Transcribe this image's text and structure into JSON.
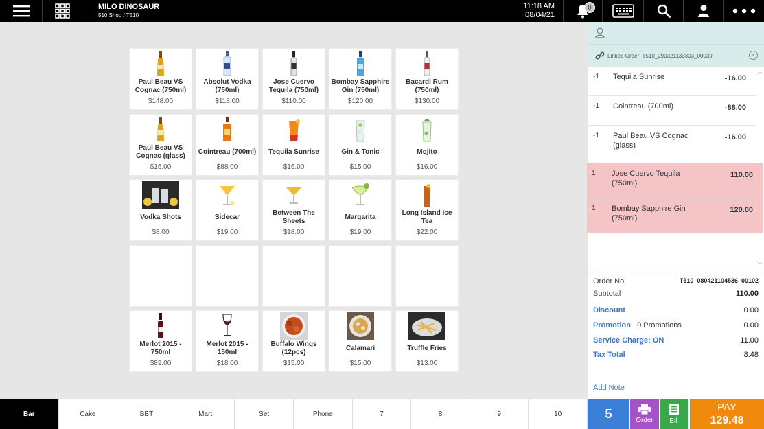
{
  "header": {
    "shop_name": "MILO DINOSAUR",
    "shop_sub": "510 Shop / T510",
    "time": "11:18 AM",
    "date": "08/04/21",
    "notification_count": "0"
  },
  "products": [
    {
      "name": "Paul Beau VS Cognac (750ml)",
      "price": "$148.00",
      "icon": "bottle-gold"
    },
    {
      "name": "Absolut Vodka (750ml)",
      "price": "$118.00",
      "icon": "bottle-clear"
    },
    {
      "name": "Jose Cuervo Tequila (750ml)",
      "price": "$110.00",
      "icon": "bottle-dark"
    },
    {
      "name": "Bombay Sapphire Gin (750ml)",
      "price": "$120.00",
      "icon": "bottle-blue"
    },
    {
      "name": "Bacardi Rum (750ml)",
      "price": "$130.00",
      "icon": "bottle-white"
    },
    {
      "name": "Paul Beau VS Cognac (glass)",
      "price": "$16.00",
      "icon": "bottle-gold"
    },
    {
      "name": "Cointreau (700ml)",
      "price": "$88.00",
      "icon": "bottle-orange"
    },
    {
      "name": "Tequila Sunrise",
      "price": "$16.00",
      "icon": "glass-sunrise"
    },
    {
      "name": "Gin & Tonic",
      "price": "$15.00",
      "icon": "glass-tonic"
    },
    {
      "name": "Mojito",
      "price": "$16.00",
      "icon": "glass-mojito"
    },
    {
      "name": "Vodka Shots",
      "price": "$8.00",
      "icon": "photo-shots"
    },
    {
      "name": "Sidecar",
      "price": "$19.00",
      "icon": "glass-sidecar"
    },
    {
      "name": "Between The Sheets",
      "price": "$18.00",
      "icon": "glass-sheets"
    },
    {
      "name": "Margarita",
      "price": "$19.00",
      "icon": "glass-margarita"
    },
    {
      "name": "Long Island Ice Tea",
      "price": "$22.00",
      "icon": "glass-longisland"
    },
    {
      "name": "",
      "price": "",
      "icon": ""
    },
    {
      "name": "",
      "price": "",
      "icon": ""
    },
    {
      "name": "",
      "price": "",
      "icon": ""
    },
    {
      "name": "",
      "price": "",
      "icon": ""
    },
    {
      "name": "",
      "price": "",
      "icon": ""
    },
    {
      "name": "Merlot 2015 - 750ml",
      "price": "$89.00",
      "icon": "wine-bottle"
    },
    {
      "name": "Merlot 2015 - 150ml",
      "price": "$18.00",
      "icon": "wine-glass"
    },
    {
      "name": "Buffalo Wings (12pcs)",
      "price": "$15.00",
      "icon": "photo-wings"
    },
    {
      "name": "Calamari",
      "price": "$15.00",
      "icon": "photo-calamari"
    },
    {
      "name": "Truffle Fries",
      "price": "$13.00",
      "icon": "photo-fries"
    }
  ],
  "panel": {
    "linked_order": "Linked Order: T510_290321133303_00039",
    "items": [
      {
        "qty": "-1",
        "name": "Tequila Sunrise",
        "price": "-16.00",
        "selected": false
      },
      {
        "qty": "-1",
        "name": "Cointreau (700ml)",
        "price": "-88.00",
        "selected": false
      },
      {
        "qty": "-1",
        "name": "Paul Beau VS Cognac (glass)",
        "price": "-16.00",
        "selected": false
      },
      {
        "qty": "1",
        "name": "Jose Cuervo Tequila (750ml)",
        "price": "110.00",
        "selected": true
      },
      {
        "qty": "1",
        "name": "Bombay Sapphire Gin (750ml)",
        "price": "120.00",
        "selected": true
      }
    ],
    "order_no_label": "Order No.",
    "order_no": "T510_080421104536_00102",
    "subtotal_label": "Subtotal",
    "subtotal": "110.00",
    "discount_label": "Discount",
    "discount": "0.00",
    "promotion_label": "Promotion",
    "promotion_count": "0 Promotions",
    "promotion": "0.00",
    "service_label": "Service Charge: ON",
    "service": "11.00",
    "tax_label": "Tax Total",
    "tax": "8.48",
    "add_note": "Add Note"
  },
  "categories": [
    "Bar",
    "Cake",
    "BBT",
    "Mart",
    "Set",
    "Phone",
    "7",
    "8",
    "9",
    "10"
  ],
  "actions": {
    "item_count": "5",
    "order_label": "Order",
    "bill_label": "Bill",
    "pay_label": "PAY",
    "pay_amount": "129.48"
  },
  "colors": {
    "accent_blue": "#3c7fd9",
    "order_purple": "#a650c9",
    "bill_green": "#3aa84a",
    "pay_orange": "#f08a0c",
    "selected_row": "#f5c4c6"
  }
}
